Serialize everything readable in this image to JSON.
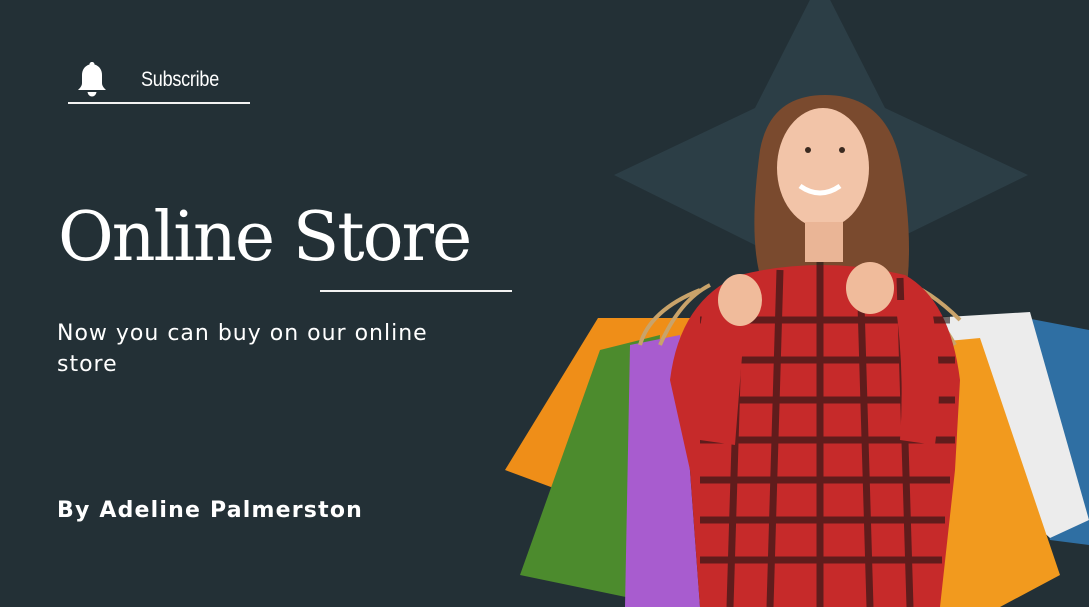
{
  "subscribe": {
    "label": "Subscribe",
    "icon": "bell-icon"
  },
  "hero": {
    "title": "Online Store",
    "subtitle": "Now you can buy on our online store",
    "author": "By Adeline Palmerston"
  },
  "image": {
    "description_icon": "shopper-with-bags-photo"
  },
  "colors": {
    "background": "#233036",
    "star": "#2c3e46",
    "text": "#ffffff",
    "shirt_red": "#c62a2a",
    "bag_orange": "#f08d1a",
    "bag_green": "#4f8a2e",
    "bag_purple": "#a259c9",
    "bag_white": "#eeeeee",
    "bag_blue": "#2f6fa3"
  }
}
